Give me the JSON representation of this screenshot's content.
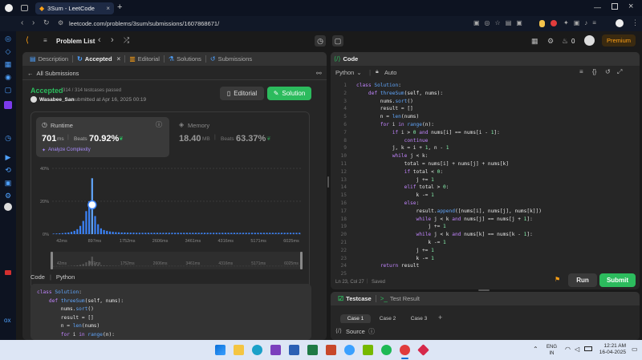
{
  "browser": {
    "tab_title": "3Sum - LeetCode",
    "url": "leetcode.com/problems/3sum/submissions/1607868671/",
    "new_tab": "+"
  },
  "nav": {
    "problem_list": "Problem List",
    "streak": "0",
    "premium": "Premium"
  },
  "left": {
    "tabs": [
      {
        "label": "Description"
      },
      {
        "label": "Accepted"
      },
      {
        "label": "Editorial"
      },
      {
        "label": "Solutions"
      },
      {
        "label": "Submissions"
      }
    ],
    "all_submissions": "All Submissions",
    "status": "Accepted",
    "testcases": "314 / 314 testcases passed",
    "user": "Wasabee_San",
    "submitted": "submitted at Apr 16, 2025 00:19",
    "editorial_btn": "Editorial",
    "solution_btn": "Solution",
    "runtime_label": "Runtime",
    "runtime_value": "701",
    "runtime_unit": "ms",
    "beats_label": "Beats",
    "runtime_beats": "70.92%",
    "analyze": "Analyze Complexity",
    "memory_label": "Memory",
    "memory_value": "18.40",
    "memory_unit": "MB",
    "memory_beats": "63.37%",
    "code_label": "Code",
    "lang_label": "Python",
    "code_preview": [
      "class Solution:",
      "    def threeSum(self, nums):",
      "        nums.sort()",
      "        result = []",
      "        n = len(nums)",
      "        for i in range(n):"
    ]
  },
  "chart_data": {
    "type": "bar",
    "ylim": [
      0,
      40
    ],
    "yticks": [
      "40%",
      "20%",
      "0%"
    ],
    "xticks": [
      "42ms",
      "897ms",
      "1752ms",
      "2606ms",
      "3461ms",
      "4316ms",
      "5171ms",
      "6025ms"
    ],
    "values": [
      0.3,
      0.4,
      0.5,
      0.6,
      0.8,
      1.0,
      1.4,
      2.0,
      3.0,
      5.0,
      8.0,
      14.0,
      20.0,
      34.0,
      11.0,
      6.0,
      3.5,
      2.5,
      2.0,
      1.6,
      1.4,
      1.2,
      1.1,
      1.0,
      1.0,
      0.9,
      0.9,
      0.9,
      0.8,
      0.8,
      0.8,
      0.8,
      0.8,
      0.8,
      0.8,
      0.8,
      0.8,
      0.8,
      0.8,
      0.8,
      0.8,
      0.8,
      0.8,
      0.8,
      0.8,
      0.8,
      0.8,
      0.8,
      0.8,
      0.8,
      0.8,
      0.8,
      0.8,
      0.8,
      0.8,
      0.8,
      0.8,
      0.8,
      0.8,
      0.8,
      0.8,
      0.8,
      0.8,
      0.8,
      0.8,
      0.8,
      0.8,
      0.8,
      0.8,
      0.8,
      0.8,
      0.8,
      0.8,
      0.8,
      0.8,
      0.8,
      0.8,
      0.8,
      0.8,
      0.8,
      0.8,
      0.8,
      0.8,
      0.8
    ],
    "highlight_index": 13,
    "bar_color": "#3b82f6"
  },
  "editor": {
    "title": "Code",
    "lang": "Python",
    "mode": "Auto",
    "status_pos": "Ln 23, Col 27",
    "status_saved": "Saved",
    "run": "Run",
    "submit": "Submit",
    "lines": [
      "class Solution:",
      "    def threeSum(self, nums):",
      "        nums.sort()",
      "        result = []",
      "        n = len(nums)",
      "        for i in range(n):",
      "            if i > 0 and nums[i] == nums[i - 1]:",
      "                continue",
      "            j, k = i + 1, n - 1",
      "            while j < k:",
      "                total = nums[i] + nums[j] + nums[k]",
      "                if total < 0:",
      "                    j += 1",
      "                elif total > 0:",
      "                    k -= 1",
      "                else:",
      "                    result.append([nums[i], nums[j], nums[k]])",
      "                    while j < k and nums[j] == nums[j + 1]:",
      "                        j += 1",
      "                    while j < k and nums[k] == nums[k - 1]:",
      "                        k -= 1",
      "                    j += 1",
      "                    k -= 1",
      "        return result",
      ""
    ]
  },
  "testpanel": {
    "testcase": "Testcase",
    "result": "Test Result",
    "cases": [
      "Case 1",
      "Case 2",
      "Case 3"
    ],
    "add": "+",
    "source": "Source"
  },
  "taskbar": {
    "lang1": "ENG",
    "lang2": "IN",
    "time": "12:21 AM",
    "date": "16-04-2025"
  },
  "colors": {
    "accent_green": "#2cbb5d",
    "accent_blue": "#3b82f6",
    "premium": "#ffa116"
  }
}
